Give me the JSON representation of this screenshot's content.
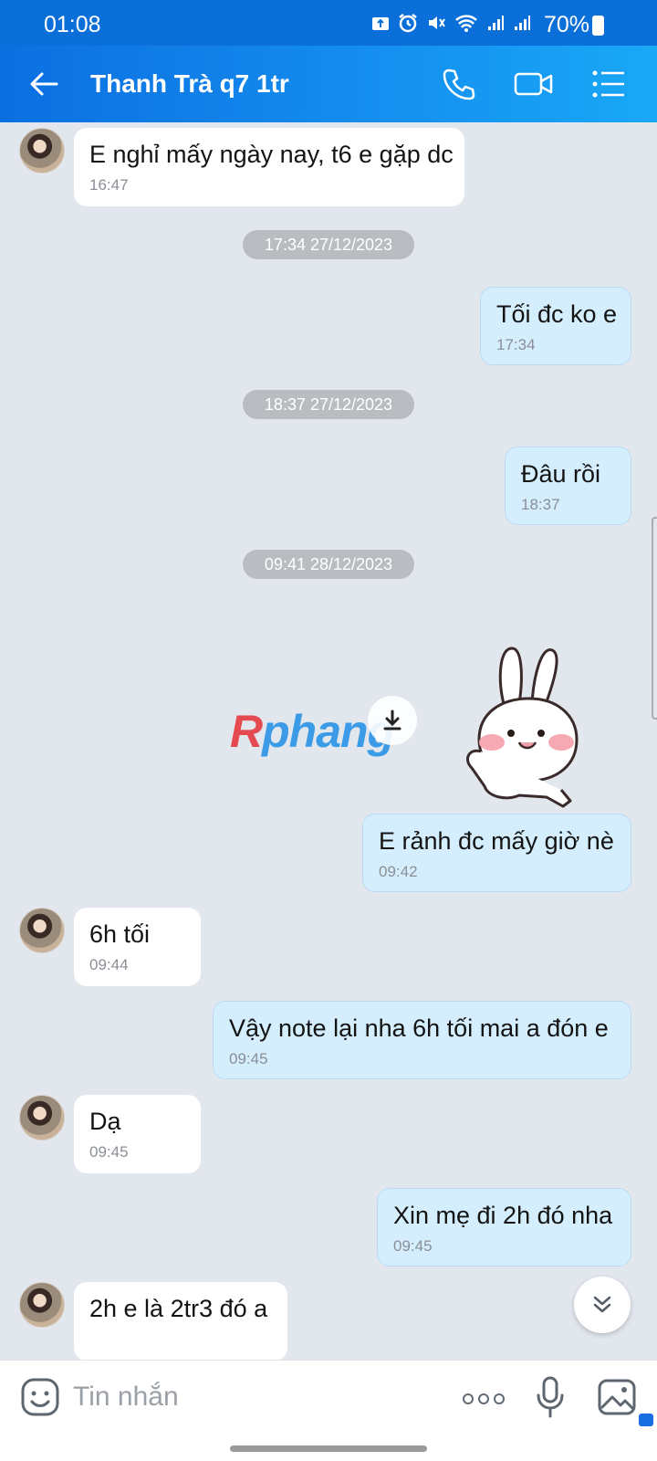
{
  "status_bar": {
    "time": "01:08",
    "battery": "70%"
  },
  "header": {
    "contact_name": "Thanh Trà q7 1tr"
  },
  "messages": [
    {
      "side": "in",
      "text": "E nghỉ mấy ngày nay, t6 e gặp dc",
      "time": "16:47"
    },
    {
      "type": "date",
      "text": "17:34 27/12/2023"
    },
    {
      "side": "out",
      "text": "Tối đc ko e",
      "time": "17:34"
    },
    {
      "type": "date",
      "text": "18:37 27/12/2023"
    },
    {
      "side": "out",
      "text": "Đâu rồi",
      "time": "18:37"
    },
    {
      "type": "date",
      "text": "09:41 28/12/2023"
    },
    {
      "side": "out",
      "text": "E rảnh đc mấy giờ nè",
      "time": "09:42"
    },
    {
      "side": "in",
      "text": "6h tối",
      "time": "09:44"
    },
    {
      "side": "out",
      "text": "Vậy note lại nha 6h tối mai a đón e",
      "time": "09:45"
    },
    {
      "side": "in",
      "text": "Dạ",
      "time": "09:45"
    },
    {
      "side": "out",
      "text": "Xin mẹ đi 2h đó nha",
      "time": "09:45"
    },
    {
      "side": "in",
      "text": "2h e là 2tr3 đó a",
      "time": ""
    }
  ],
  "watermark": {
    "part1": "R",
    "part2": "phang"
  },
  "input": {
    "placeholder": "Tin nhắn"
  },
  "colors": {
    "header_start": "#0c6fe0",
    "header_end": "#19a8f6",
    "out_bubble": "#d5eefd",
    "in_bubble": "#ffffff",
    "chat_bg": "#e2e7ee"
  }
}
